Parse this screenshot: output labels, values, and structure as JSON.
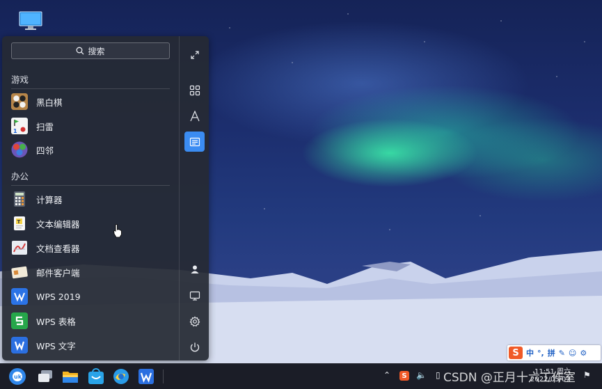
{
  "search": {
    "label": "搜索"
  },
  "sections": [
    {
      "title": "游戏",
      "apps": [
        {
          "label": "黑白棋",
          "icon": "reversi-icon"
        },
        {
          "label": "扫雷",
          "icon": "minesweeper-icon"
        },
        {
          "label": "四邻",
          "icon": "four-in-a-row-icon"
        }
      ]
    },
    {
      "title": "办公",
      "apps": [
        {
          "label": "计算器",
          "icon": "calculator-icon"
        },
        {
          "label": "文本编辑器",
          "icon": "text-editor-icon"
        },
        {
          "label": "文档查看器",
          "icon": "document-viewer-icon"
        },
        {
          "label": "邮件客户端",
          "icon": "mail-client-icon"
        },
        {
          "label": "WPS 2019",
          "icon": "wps-2019-icon"
        },
        {
          "label": "WPS 表格",
          "icon": "wps-spreadsheet-icon"
        },
        {
          "label": "WPS 文字",
          "icon": "wps-writer-icon"
        }
      ]
    }
  ],
  "sidebar": [
    {
      "icon": "expand-icon",
      "active": false
    },
    {
      "icon": "all-apps-grid-icon",
      "active": false
    },
    {
      "icon": "alphabetical-sort-icon",
      "active": false
    },
    {
      "icon": "category-view-icon",
      "active": true
    },
    {
      "icon": "user-icon",
      "active": false
    },
    {
      "icon": "computer-icon",
      "active": false
    },
    {
      "icon": "settings-gear-icon",
      "active": false
    },
    {
      "icon": "power-icon",
      "active": false
    }
  ],
  "taskbar": {
    "apps": [
      "start-menu-icon",
      "multitask-view-icon",
      "file-manager-icon",
      "software-store-icon",
      "browser-icon",
      "wps-icon"
    ],
    "clock_time": "11:51 周六",
    "clock_date": "2022/05/07"
  },
  "ime": {
    "items": [
      "中",
      "°,",
      "拼",
      "✎",
      "☺",
      "⚙"
    ]
  },
  "watermark": "CSDN @正月十六工作室",
  "colors": {
    "accent": "#3b8cf2",
    "menu_bg": "#262a34",
    "ime_brand": "#f05a28"
  }
}
